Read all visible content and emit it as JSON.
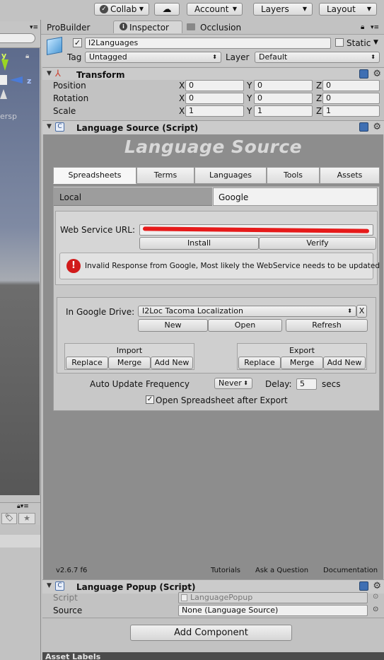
{
  "toolbar": {
    "collab_label": "Collab",
    "account_label": "Account",
    "layers_label": "Layers",
    "layout_label": "Layout"
  },
  "window_tabs": {
    "probuilder": "ProBuilder",
    "inspector": "Inspector",
    "occlusion": "Occlusion"
  },
  "scene": {
    "axis_y": "y",
    "axis_z": "z",
    "persp": "ersp"
  },
  "gameobject": {
    "name": "I2Languages",
    "static_label": "Static",
    "tag_label": "Tag",
    "tag_value": "Untagged",
    "layer_label": "Layer",
    "layer_value": "Default"
  },
  "transform": {
    "title": "Transform",
    "rows": [
      {
        "label": "Position",
        "x": "0",
        "y": "0",
        "z": "0"
      },
      {
        "label": "Rotation",
        "x": "0",
        "y": "0",
        "z": "0"
      },
      {
        "label": "Scale",
        "x": "1",
        "y": "1",
        "z": "1"
      }
    ],
    "axis_x": "X",
    "axis_y": "Y",
    "axis_z": "Z"
  },
  "language_source": {
    "title": "Language Source (Script)",
    "banner": "Language Source",
    "tabs": [
      "Spreadsheets",
      "Terms",
      "Languages",
      "Tools",
      "Assets"
    ],
    "subtabs": [
      "Local",
      "Google"
    ],
    "web_service_label": "Web Service URL:",
    "install_label": "Install",
    "verify_label": "Verify",
    "error_message": "Invalid Response from Google, Most likely the WebService needs to be updated",
    "drive_label": "In Google Drive:",
    "drive_value": "I2Loc Tacoma Localization",
    "drive_clear": "X",
    "new_label": "New",
    "open_label": "Open",
    "refresh_label": "Refresh",
    "import_title": "Import",
    "export_title": "Export",
    "replace_label": "Replace",
    "merge_label": "Merge",
    "add_new_label": "Add New",
    "auto_update_label": "Auto Update Frequency",
    "auto_update_value": "Never",
    "delay_label": "Delay:",
    "delay_value": "5",
    "secs_label": "secs",
    "open_after_export_label": "Open Spreadsheet after Export",
    "version": "v2.6.7 f6",
    "tutorials_link": "Tutorials",
    "ask_link": "Ask a Question",
    "docs_link": "Documentation"
  },
  "language_popup": {
    "title": "Language Popup (Script)",
    "script_label": "Script",
    "script_value": "LanguagePopup",
    "source_label": "Source",
    "source_value": "None (Language Source)"
  },
  "add_component_label": "Add Component",
  "asset_labels_label": "Asset Labels",
  "colors": {
    "error_red": "#d11a1a",
    "component_blue": "#3f6fb3",
    "scene_sky": "#5a6a8a"
  }
}
